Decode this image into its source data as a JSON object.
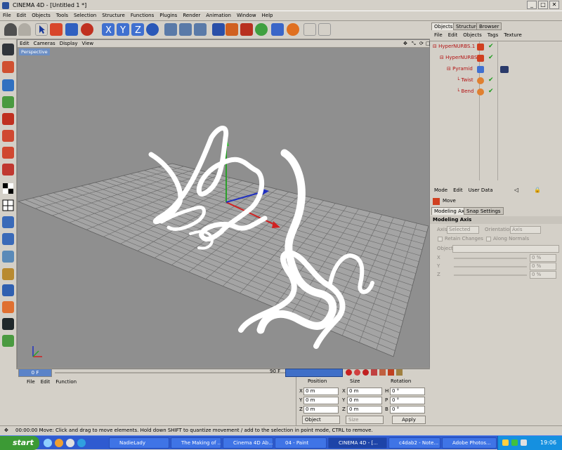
{
  "window": {
    "title": "CINEMA 4D - [Untitled 1 *]",
    "minimize": "_",
    "maximize": "□",
    "close": "✕"
  },
  "menubar": [
    "File",
    "Edit",
    "Objects",
    "Tools",
    "Selection",
    "Structure",
    "Functions",
    "Plugins",
    "Render",
    "Animation",
    "Window",
    "Help"
  ],
  "viewport": {
    "menu": [
      "Edit",
      "Cameras",
      "Display",
      "View"
    ],
    "label": "Perspective"
  },
  "timeline": {
    "current": "0 F",
    "end": "90 F"
  },
  "objects_panel": {
    "tabs": [
      "Objects",
      "Structure",
      "Browser"
    ],
    "menu": [
      "File",
      "Edit",
      "Objects",
      "Tags",
      "Texture"
    ],
    "tree": [
      "HyperNURBS.1",
      "HyperNURBS",
      "Pyramid",
      "Twist",
      "Bend"
    ]
  },
  "attributes_panel": {
    "menu": [
      "Mode",
      "Edit",
      "User Data"
    ],
    "tool_name": "Move",
    "tabs": [
      "Modeling Axis",
      "Snap Settings"
    ],
    "section": "Modeling Axis",
    "axis_label": "Axis",
    "axis_value": "Selected",
    "orientation_label": "Orientation",
    "orientation_value": "Axis",
    "retain_changes": "Retain Changes",
    "along_normals": "Along Normals",
    "object_label": "Object",
    "x": "X",
    "y": "Y",
    "z": "Z",
    "x_val": "0 %",
    "y_val": "0 %",
    "z_val": "0 %"
  },
  "material_panel": {
    "menu": [
      "File",
      "Edit",
      "Function"
    ]
  },
  "coords": {
    "headers": [
      "Position",
      "Size",
      "Rotation"
    ],
    "pos_labels": [
      "X",
      "Y",
      "Z"
    ],
    "pos_values": [
      "0 m",
      "0 m",
      "0 m"
    ],
    "size_labels": [
      "X",
      "Y",
      "Z"
    ],
    "size_values": [
      "0 m",
      "0 m",
      "0 m"
    ],
    "rot_labels": [
      "H",
      "P",
      "B"
    ],
    "rot_values": [
      "0 °",
      "0 °",
      "0 °"
    ],
    "mode": "Object",
    "size_mode": "Size",
    "apply": "Apply"
  },
  "status": "00:00:00  Move: Click and drag to move elements. Hold down SHIFT to quantize movement / add to the selection in point mode, CTRL to remove.",
  "taskbar": {
    "start": "start",
    "tasks": [
      "NadieLady",
      "The Making of ...",
      "Cinema 4D Ab...",
      "04 - Paint",
      "CINEMA 4D - [...",
      "c4dab2 - Note...",
      "Adobe Photos..."
    ],
    "clock": "19:06"
  }
}
